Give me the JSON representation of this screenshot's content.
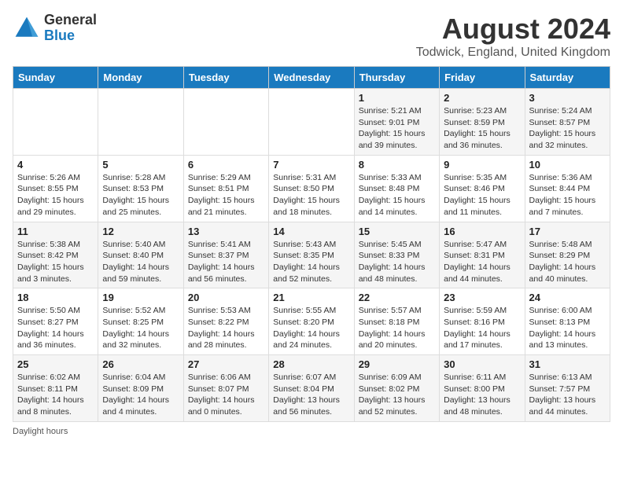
{
  "header": {
    "logo_line1": "General",
    "logo_line2": "Blue",
    "title": "August 2024",
    "subtitle": "Todwick, England, United Kingdom"
  },
  "days_of_week": [
    "Sunday",
    "Monday",
    "Tuesday",
    "Wednesday",
    "Thursday",
    "Friday",
    "Saturday"
  ],
  "weeks": [
    [
      {
        "day": "",
        "sunrise": "",
        "sunset": "",
        "daylight": ""
      },
      {
        "day": "",
        "sunrise": "",
        "sunset": "",
        "daylight": ""
      },
      {
        "day": "",
        "sunrise": "",
        "sunset": "",
        "daylight": ""
      },
      {
        "day": "",
        "sunrise": "",
        "sunset": "",
        "daylight": ""
      },
      {
        "day": "1",
        "sunrise": "Sunrise: 5:21 AM",
        "sunset": "Sunset: 9:01 PM",
        "daylight": "Daylight: 15 hours and 39 minutes."
      },
      {
        "day": "2",
        "sunrise": "Sunrise: 5:23 AM",
        "sunset": "Sunset: 8:59 PM",
        "daylight": "Daylight: 15 hours and 36 minutes."
      },
      {
        "day": "3",
        "sunrise": "Sunrise: 5:24 AM",
        "sunset": "Sunset: 8:57 PM",
        "daylight": "Daylight: 15 hours and 32 minutes."
      }
    ],
    [
      {
        "day": "4",
        "sunrise": "Sunrise: 5:26 AM",
        "sunset": "Sunset: 8:55 PM",
        "daylight": "Daylight: 15 hours and 29 minutes."
      },
      {
        "day": "5",
        "sunrise": "Sunrise: 5:28 AM",
        "sunset": "Sunset: 8:53 PM",
        "daylight": "Daylight: 15 hours and 25 minutes."
      },
      {
        "day": "6",
        "sunrise": "Sunrise: 5:29 AM",
        "sunset": "Sunset: 8:51 PM",
        "daylight": "Daylight: 15 hours and 21 minutes."
      },
      {
        "day": "7",
        "sunrise": "Sunrise: 5:31 AM",
        "sunset": "Sunset: 8:50 PM",
        "daylight": "Daylight: 15 hours and 18 minutes."
      },
      {
        "day": "8",
        "sunrise": "Sunrise: 5:33 AM",
        "sunset": "Sunset: 8:48 PM",
        "daylight": "Daylight: 15 hours and 14 minutes."
      },
      {
        "day": "9",
        "sunrise": "Sunrise: 5:35 AM",
        "sunset": "Sunset: 8:46 PM",
        "daylight": "Daylight: 15 hours and 11 minutes."
      },
      {
        "day": "10",
        "sunrise": "Sunrise: 5:36 AM",
        "sunset": "Sunset: 8:44 PM",
        "daylight": "Daylight: 15 hours and 7 minutes."
      }
    ],
    [
      {
        "day": "11",
        "sunrise": "Sunrise: 5:38 AM",
        "sunset": "Sunset: 8:42 PM",
        "daylight": "Daylight: 15 hours and 3 minutes."
      },
      {
        "day": "12",
        "sunrise": "Sunrise: 5:40 AM",
        "sunset": "Sunset: 8:40 PM",
        "daylight": "Daylight: 14 hours and 59 minutes."
      },
      {
        "day": "13",
        "sunrise": "Sunrise: 5:41 AM",
        "sunset": "Sunset: 8:37 PM",
        "daylight": "Daylight: 14 hours and 56 minutes."
      },
      {
        "day": "14",
        "sunrise": "Sunrise: 5:43 AM",
        "sunset": "Sunset: 8:35 PM",
        "daylight": "Daylight: 14 hours and 52 minutes."
      },
      {
        "day": "15",
        "sunrise": "Sunrise: 5:45 AM",
        "sunset": "Sunset: 8:33 PM",
        "daylight": "Daylight: 14 hours and 48 minutes."
      },
      {
        "day": "16",
        "sunrise": "Sunrise: 5:47 AM",
        "sunset": "Sunset: 8:31 PM",
        "daylight": "Daylight: 14 hours and 44 minutes."
      },
      {
        "day": "17",
        "sunrise": "Sunrise: 5:48 AM",
        "sunset": "Sunset: 8:29 PM",
        "daylight": "Daylight: 14 hours and 40 minutes."
      }
    ],
    [
      {
        "day": "18",
        "sunrise": "Sunrise: 5:50 AM",
        "sunset": "Sunset: 8:27 PM",
        "daylight": "Daylight: 14 hours and 36 minutes."
      },
      {
        "day": "19",
        "sunrise": "Sunrise: 5:52 AM",
        "sunset": "Sunset: 8:25 PM",
        "daylight": "Daylight: 14 hours and 32 minutes."
      },
      {
        "day": "20",
        "sunrise": "Sunrise: 5:53 AM",
        "sunset": "Sunset: 8:22 PM",
        "daylight": "Daylight: 14 hours and 28 minutes."
      },
      {
        "day": "21",
        "sunrise": "Sunrise: 5:55 AM",
        "sunset": "Sunset: 8:20 PM",
        "daylight": "Daylight: 14 hours and 24 minutes."
      },
      {
        "day": "22",
        "sunrise": "Sunrise: 5:57 AM",
        "sunset": "Sunset: 8:18 PM",
        "daylight": "Daylight: 14 hours and 20 minutes."
      },
      {
        "day": "23",
        "sunrise": "Sunrise: 5:59 AM",
        "sunset": "Sunset: 8:16 PM",
        "daylight": "Daylight: 14 hours and 17 minutes."
      },
      {
        "day": "24",
        "sunrise": "Sunrise: 6:00 AM",
        "sunset": "Sunset: 8:13 PM",
        "daylight": "Daylight: 14 hours and 13 minutes."
      }
    ],
    [
      {
        "day": "25",
        "sunrise": "Sunrise: 6:02 AM",
        "sunset": "Sunset: 8:11 PM",
        "daylight": "Daylight: 14 hours and 8 minutes."
      },
      {
        "day": "26",
        "sunrise": "Sunrise: 6:04 AM",
        "sunset": "Sunset: 8:09 PM",
        "daylight": "Daylight: 14 hours and 4 minutes."
      },
      {
        "day": "27",
        "sunrise": "Sunrise: 6:06 AM",
        "sunset": "Sunset: 8:07 PM",
        "daylight": "Daylight: 14 hours and 0 minutes."
      },
      {
        "day": "28",
        "sunrise": "Sunrise: 6:07 AM",
        "sunset": "Sunset: 8:04 PM",
        "daylight": "Daylight: 13 hours and 56 minutes."
      },
      {
        "day": "29",
        "sunrise": "Sunrise: 6:09 AM",
        "sunset": "Sunset: 8:02 PM",
        "daylight": "Daylight: 13 hours and 52 minutes."
      },
      {
        "day": "30",
        "sunrise": "Sunrise: 6:11 AM",
        "sunset": "Sunset: 8:00 PM",
        "daylight": "Daylight: 13 hours and 48 minutes."
      },
      {
        "day": "31",
        "sunrise": "Sunrise: 6:13 AM",
        "sunset": "Sunset: 7:57 PM",
        "daylight": "Daylight: 13 hours and 44 minutes."
      }
    ]
  ],
  "footer": "Daylight hours"
}
